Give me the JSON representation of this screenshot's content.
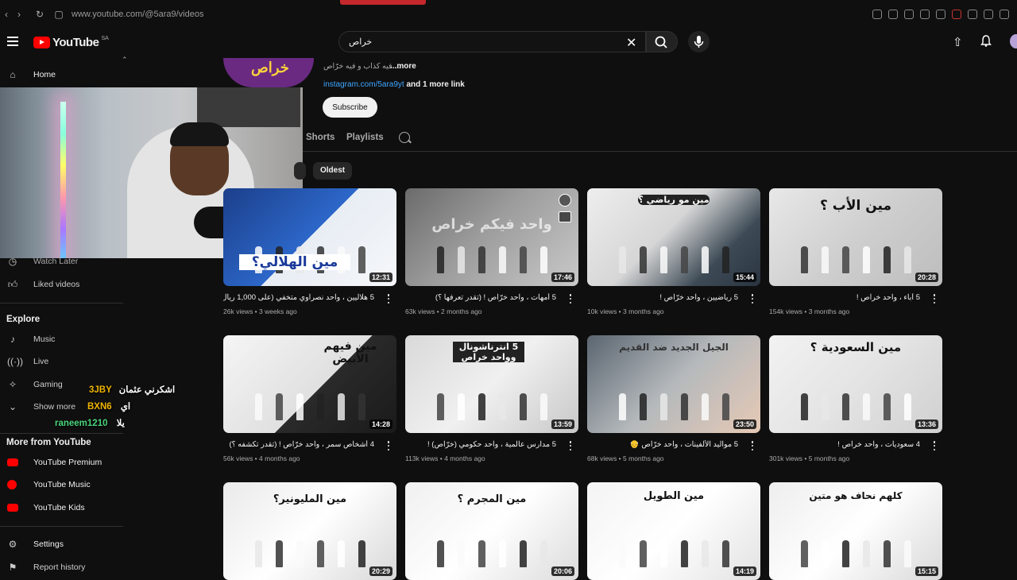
{
  "browser": {
    "url": "www.youtube.com/@5ara9/videos"
  },
  "masthead": {
    "logo_text": "YouTube",
    "country_code": "SA",
    "search_value": "خراص"
  },
  "sidebar": {
    "home": "Home",
    "watch_later": "Watch Later",
    "liked_videos": "Liked videos",
    "explore_heading": "Explore",
    "explore_items": [
      "Music",
      "Live",
      "Gaming"
    ],
    "show_more": "Show more",
    "more_heading": "More from YouTube",
    "more_items": [
      "YouTube Premium",
      "YouTube Music",
      "YouTube Kids"
    ],
    "settings": "Settings",
    "report_history": "Report history"
  },
  "channel": {
    "description": "... فيه كذاب و فيه خرّاص",
    "more": "...more",
    "link": "instagram.com/5ara9yt",
    "link_suffix": "and 1 more link",
    "subscribe": "Subscribe",
    "avatar_text": "خراص"
  },
  "tabs": [
    "Shorts",
    "Playlists"
  ],
  "chips": {
    "oldest": "Oldest"
  },
  "videos": [
    {
      "title": "5 هلاليين ، واحد نصراوي متخفي (على 1,000 ريال سعودي)",
      "meta": "26k views • 3 weeks ago",
      "duration": "12:31",
      "overlay": "مين الهلالي؟"
    },
    {
      "title": "5 أمهات ، واحد خرّاص ! (تقدر تعرفها ؟)",
      "meta": "63k views • 2 months ago",
      "duration": "17:46",
      "overlay": "واحد فيكم خراص"
    },
    {
      "title": "5 رياضيين ، واحد خرّاص !",
      "meta": "10k views • 3 months ago",
      "duration": "15:44",
      "overlay": "مين مو رياضي ؟"
    },
    {
      "title": "5 آباء ، واحد خراص !",
      "meta": "154k views • 3 months ago",
      "duration": "20:28",
      "overlay": "مين الأب ؟"
    },
    {
      "title": "4 أشخاص سمر ، واحد خرّاص ! (تقدر تكشفه ؟)",
      "meta": "56k views • 4 months ago",
      "duration": "14:28",
      "overlay": "مين فيهم الأبيض"
    },
    {
      "title": "5 مدارس عالمية ، واحد حكومي (خرّاص) !",
      "meta": "113k views • 4 months ago",
      "duration": "13:59",
      "overlay": "5 انترناشونال وواحد خراص"
    },
    {
      "title": "5 مواليد الألفينات ، واحد خرّاص 👴",
      "meta": "68k views • 5 months ago",
      "duration": "23:50",
      "overlay": "الجيل الجديد ضد القديم"
    },
    {
      "title": "4 سعوديات ، واحد خراص !",
      "meta": "301k views • 5 months ago",
      "duration": "13:36",
      "overlay": "مين السعودية ؟"
    },
    {
      "title": "",
      "meta": "",
      "duration": "20:29",
      "overlay": "مين المليونير؟"
    },
    {
      "title": "",
      "meta": "",
      "duration": "20:06",
      "overlay": "مين المجرم ؟"
    },
    {
      "title": "",
      "meta": "",
      "duration": "14:19",
      "overlay": "مين الطويل"
    },
    {
      "title": "",
      "meta": "",
      "duration": "15:15",
      "overlay": "كلهم نحاف هو متين"
    }
  ],
  "chat": [
    {
      "user": "3JBY",
      "message": "اشكرني عثمان",
      "color": "#f0b400"
    },
    {
      "user": "BXN6",
      "message": "اي",
      "color": "#f0b400"
    },
    {
      "user": "raneem1210",
      "message": "يلا",
      "color": "#49d37b"
    }
  ],
  "colors": {
    "background": "#0f0f0f",
    "brand_red": "#ff0000",
    "link": "#3ea6ff"
  }
}
